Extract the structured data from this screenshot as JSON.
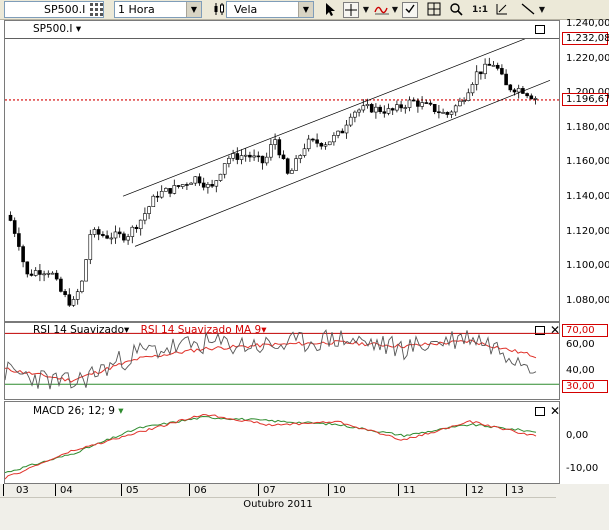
{
  "toolbar": {
    "symbol": "SP500.I",
    "timeframe": "1 Hora",
    "chart_style": "Vela",
    "zoom_label": "1:1",
    "icons": [
      "grid-icon",
      "dropdown-icon",
      "chart-style-icon",
      "pointer-icon",
      "crosshair-icon",
      "crosshair-menu-icon",
      "indicator-icon",
      "indicator-menu-icon",
      "checkbox-icon",
      "magnifier-icon",
      "zoom-reset-icon",
      "trendline-icon",
      "draw-menu-icon"
    ]
  },
  "price_pane": {
    "label": "SP500.I",
    "y_ticks": [
      "1.240,00",
      "1.220,00",
      "1.200,00",
      "1.180,00",
      "1.160,00",
      "1.140,00",
      "1.120,00",
      "1.100,00",
      "1.080,00"
    ],
    "high_tag": "1.232,08",
    "last_tag": "1.196,67"
  },
  "rsi_pane": {
    "label": "RSI 14 Suavizado",
    "ma_label": "RSI 14 Suavizado MA 9",
    "upper_tag": "70,00",
    "lower_tag": "30,00",
    "y_ticks": [
      "60,00",
      "40,00"
    ]
  },
  "macd_pane": {
    "label": "MACD 26; 12; 9",
    "y_ticks": [
      "0,00",
      "-10,00"
    ]
  },
  "x_axis": {
    "labels": [
      "03",
      "04",
      "05",
      "06",
      "07",
      "10",
      "11",
      "12",
      "13"
    ],
    "month": "Outubro 2011"
  },
  "colors": {
    "bull_candle": "#ffffff",
    "bear_candle": "#000000",
    "last_price_line": "#d30000",
    "rsi_line": "#555555",
    "rsi_ma_line": "#e0332b",
    "macd_line": "#2e8b2e",
    "signal_line": "#e0332b"
  },
  "chart_data": [
    {
      "type": "line",
      "title": "SP500.I",
      "x": [
        "03",
        "04",
        "05",
        "06",
        "07",
        "10",
        "11",
        "12",
        "13"
      ],
      "series": [
        {
          "name": "SP500.I",
          "values": [
            1130,
            1080,
            1118,
            1150,
            1168,
            1193,
            1192,
            1210,
            1197
          ]
        }
      ],
      "ylim": [
        1070,
        1240
      ],
      "annotations": [
        "1.232,08",
        "1.196,67"
      ]
    },
    {
      "type": "line",
      "title": "RSI 14 Suavizado",
      "x": [
        "03",
        "04",
        "05",
        "06",
        "07",
        "10",
        "11",
        "12",
        "13"
      ],
      "series": [
        {
          "name": "RSI 14 Suavizado",
          "values": [
            40,
            30,
            55,
            62,
            60,
            66,
            58,
            68,
            45
          ]
        },
        {
          "name": "RSI 14 Suavizado MA 9",
          "values": [
            42,
            33,
            50,
            58,
            61,
            63,
            60,
            64,
            52
          ]
        }
      ],
      "ylim": [
        20,
        75
      ],
      "annotations": [
        "70,00",
        "30,00"
      ]
    },
    {
      "type": "line",
      "title": "MACD 26; 12; 9",
      "x": [
        "03",
        "04",
        "05",
        "06",
        "07",
        "10",
        "11",
        "12",
        "13"
      ],
      "series": [
        {
          "name": "MACD 26; 12; 9",
          "values": [
            -10,
            -5,
            2,
            5,
            4,
            3,
            0,
            3,
            1
          ]
        }
      ],
      "ylim": [
        -12,
        8
      ]
    }
  ]
}
